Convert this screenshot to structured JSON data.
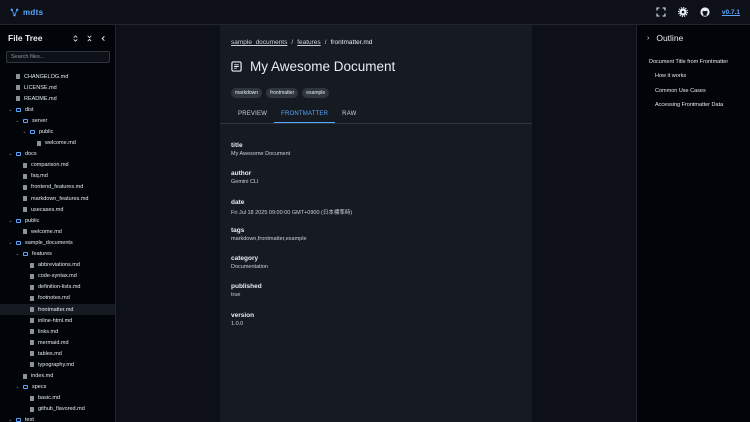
{
  "app": {
    "logo_text": "mdts",
    "version": "v0.7.1"
  },
  "icons": [
    "fullscreen-icon",
    "settings-gear-icon",
    "github-icon"
  ],
  "sidebar": {
    "title": "File Tree",
    "search_placeholder": "Search files...",
    "items": [
      {
        "label": "CHANGELOG.md",
        "type": "file",
        "depth": 0
      },
      {
        "label": "LICENSE.md",
        "type": "file",
        "depth": 0
      },
      {
        "label": "README.md",
        "type": "file",
        "depth": 0
      },
      {
        "label": "dist",
        "type": "folder",
        "depth": 0
      },
      {
        "label": "server",
        "type": "folder",
        "depth": 1
      },
      {
        "label": "public",
        "type": "folder",
        "depth": 2
      },
      {
        "label": "welcome.md",
        "type": "file",
        "depth": 3
      },
      {
        "label": "docs",
        "type": "folder",
        "depth": 0
      },
      {
        "label": "comparison.md",
        "type": "file",
        "depth": 1
      },
      {
        "label": "faq.md",
        "type": "file",
        "depth": 1
      },
      {
        "label": "frontend_features.md",
        "type": "file",
        "depth": 1
      },
      {
        "label": "markdown_features.md",
        "type": "file",
        "depth": 1
      },
      {
        "label": "usecases.md",
        "type": "file",
        "depth": 1
      },
      {
        "label": "public",
        "type": "folder",
        "depth": 0
      },
      {
        "label": "welcome.md",
        "type": "file",
        "depth": 1
      },
      {
        "label": "sample_documents",
        "type": "folder",
        "depth": 0
      },
      {
        "label": "features",
        "type": "folder",
        "depth": 1
      },
      {
        "label": "abbreviations.md",
        "type": "file",
        "depth": 2
      },
      {
        "label": "code-syntax.md",
        "type": "file",
        "depth": 2
      },
      {
        "label": "definition-lists.md",
        "type": "file",
        "depth": 2
      },
      {
        "label": "footnotes.md",
        "type": "file",
        "depth": 2
      },
      {
        "label": "frontmatter.md",
        "type": "file",
        "depth": 2,
        "selected": true
      },
      {
        "label": "inline-html.md",
        "type": "file",
        "depth": 2
      },
      {
        "label": "links.md",
        "type": "file",
        "depth": 2
      },
      {
        "label": "mermaid.md",
        "type": "file",
        "depth": 2
      },
      {
        "label": "tables.md",
        "type": "file",
        "depth": 2
      },
      {
        "label": "typography.md",
        "type": "file",
        "depth": 2
      },
      {
        "label": "index.md",
        "type": "file",
        "depth": 1
      },
      {
        "label": "specs",
        "type": "folder",
        "depth": 1
      },
      {
        "label": "basic.md",
        "type": "file",
        "depth": 2
      },
      {
        "label": "github_flavored.md",
        "type": "file",
        "depth": 2
      },
      {
        "label": "test",
        "type": "folder",
        "depth": 0
      }
    ]
  },
  "document": {
    "breadcrumb": [
      "sample_documents",
      "features",
      "frontmatter.md"
    ],
    "title": "My Awesome Document",
    "tags": [
      "markdown",
      "frontmatter",
      "example"
    ],
    "tabs": [
      {
        "label": "PREVIEW",
        "active": false
      },
      {
        "label": "FRONTMATTER",
        "active": true
      },
      {
        "label": "RAW",
        "active": false
      }
    ],
    "frontmatter": [
      {
        "key": "title",
        "value": "My Awesome Document"
      },
      {
        "key": "author",
        "value": "Gemini CLI"
      },
      {
        "key": "date",
        "value": "Fri Jul 18 2025 09:00:00 GMT+0900 (日本標準時)"
      },
      {
        "key": "tags",
        "value": "markdown,frontmatter,example"
      },
      {
        "key": "category",
        "value": "Documentation"
      },
      {
        "key": "published",
        "value": "true"
      },
      {
        "key": "version",
        "value": "1.0.0"
      }
    ]
  },
  "outline": {
    "title": "Outline",
    "items": [
      {
        "label": "Document Title from Frontmatter",
        "level": 1
      },
      {
        "label": "How it works",
        "level": 2
      },
      {
        "label": "Common Use Cases",
        "level": 2
      },
      {
        "label": "Accessing Frontmatter Data",
        "level": 2
      }
    ]
  },
  "colors": {
    "accent": "#58a6ff",
    "background": "#0d1117",
    "panel": "#161b22",
    "sidebar": "#010409"
  }
}
